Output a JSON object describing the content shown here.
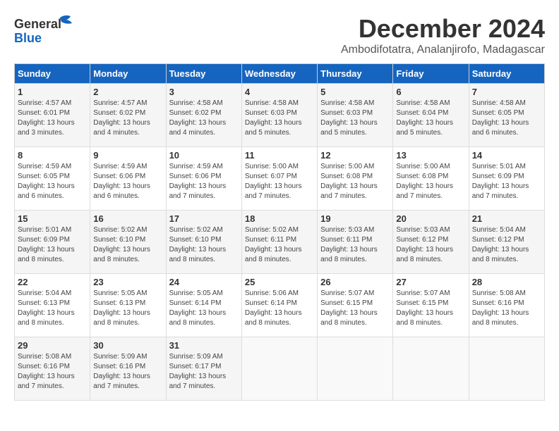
{
  "header": {
    "logo_line1": "General",
    "logo_line2": "Blue",
    "month_title": "December 2024",
    "subtitle": "Ambodifotatra, Analanjirofo, Madagascar"
  },
  "days_of_week": [
    "Sunday",
    "Monday",
    "Tuesday",
    "Wednesday",
    "Thursday",
    "Friday",
    "Saturday"
  ],
  "weeks": [
    [
      {
        "day": 1,
        "sunrise": "4:57 AM",
        "sunset": "6:01 PM",
        "daylight": "13 hours and 3 minutes."
      },
      {
        "day": 2,
        "sunrise": "4:57 AM",
        "sunset": "6:02 PM",
        "daylight": "13 hours and 4 minutes."
      },
      {
        "day": 3,
        "sunrise": "4:58 AM",
        "sunset": "6:02 PM",
        "daylight": "13 hours and 4 minutes."
      },
      {
        "day": 4,
        "sunrise": "4:58 AM",
        "sunset": "6:03 PM",
        "daylight": "13 hours and 5 minutes."
      },
      {
        "day": 5,
        "sunrise": "4:58 AM",
        "sunset": "6:03 PM",
        "daylight": "13 hours and 5 minutes."
      },
      {
        "day": 6,
        "sunrise": "4:58 AM",
        "sunset": "6:04 PM",
        "daylight": "13 hours and 5 minutes."
      },
      {
        "day": 7,
        "sunrise": "4:58 AM",
        "sunset": "6:05 PM",
        "daylight": "13 hours and 6 minutes."
      }
    ],
    [
      {
        "day": 8,
        "sunrise": "4:59 AM",
        "sunset": "6:05 PM",
        "daylight": "13 hours and 6 minutes."
      },
      {
        "day": 9,
        "sunrise": "4:59 AM",
        "sunset": "6:06 PM",
        "daylight": "13 hours and 6 minutes."
      },
      {
        "day": 10,
        "sunrise": "4:59 AM",
        "sunset": "6:06 PM",
        "daylight": "13 hours and 7 minutes."
      },
      {
        "day": 11,
        "sunrise": "5:00 AM",
        "sunset": "6:07 PM",
        "daylight": "13 hours and 7 minutes."
      },
      {
        "day": 12,
        "sunrise": "5:00 AM",
        "sunset": "6:08 PM",
        "daylight": "13 hours and 7 minutes."
      },
      {
        "day": 13,
        "sunrise": "5:00 AM",
        "sunset": "6:08 PM",
        "daylight": "13 hours and 7 minutes."
      },
      {
        "day": 14,
        "sunrise": "5:01 AM",
        "sunset": "6:09 PM",
        "daylight": "13 hours and 7 minutes."
      }
    ],
    [
      {
        "day": 15,
        "sunrise": "5:01 AM",
        "sunset": "6:09 PM",
        "daylight": "13 hours and 8 minutes."
      },
      {
        "day": 16,
        "sunrise": "5:02 AM",
        "sunset": "6:10 PM",
        "daylight": "13 hours and 8 minutes."
      },
      {
        "day": 17,
        "sunrise": "5:02 AM",
        "sunset": "6:10 PM",
        "daylight": "13 hours and 8 minutes."
      },
      {
        "day": 18,
        "sunrise": "5:02 AM",
        "sunset": "6:11 PM",
        "daylight": "13 hours and 8 minutes."
      },
      {
        "day": 19,
        "sunrise": "5:03 AM",
        "sunset": "6:11 PM",
        "daylight": "13 hours and 8 minutes."
      },
      {
        "day": 20,
        "sunrise": "5:03 AM",
        "sunset": "6:12 PM",
        "daylight": "13 hours and 8 minutes."
      },
      {
        "day": 21,
        "sunrise": "5:04 AM",
        "sunset": "6:12 PM",
        "daylight": "13 hours and 8 minutes."
      }
    ],
    [
      {
        "day": 22,
        "sunrise": "5:04 AM",
        "sunset": "6:13 PM",
        "daylight": "13 hours and 8 minutes."
      },
      {
        "day": 23,
        "sunrise": "5:05 AM",
        "sunset": "6:13 PM",
        "daylight": "13 hours and 8 minutes."
      },
      {
        "day": 24,
        "sunrise": "5:05 AM",
        "sunset": "6:14 PM",
        "daylight": "13 hours and 8 minutes."
      },
      {
        "day": 25,
        "sunrise": "5:06 AM",
        "sunset": "6:14 PM",
        "daylight": "13 hours and 8 minutes."
      },
      {
        "day": 26,
        "sunrise": "5:07 AM",
        "sunset": "6:15 PM",
        "daylight": "13 hours and 8 minutes."
      },
      {
        "day": 27,
        "sunrise": "5:07 AM",
        "sunset": "6:15 PM",
        "daylight": "13 hours and 8 minutes."
      },
      {
        "day": 28,
        "sunrise": "5:08 AM",
        "sunset": "6:16 PM",
        "daylight": "13 hours and 8 minutes."
      }
    ],
    [
      {
        "day": 29,
        "sunrise": "5:08 AM",
        "sunset": "6:16 PM",
        "daylight": "13 hours and 7 minutes."
      },
      {
        "day": 30,
        "sunrise": "5:09 AM",
        "sunset": "6:16 PM",
        "daylight": "13 hours and 7 minutes."
      },
      {
        "day": 31,
        "sunrise": "5:09 AM",
        "sunset": "6:17 PM",
        "daylight": "13 hours and 7 minutes."
      },
      null,
      null,
      null,
      null
    ]
  ],
  "labels": {
    "sunrise": "Sunrise:",
    "sunset": "Sunset:",
    "daylight": "Daylight:"
  }
}
